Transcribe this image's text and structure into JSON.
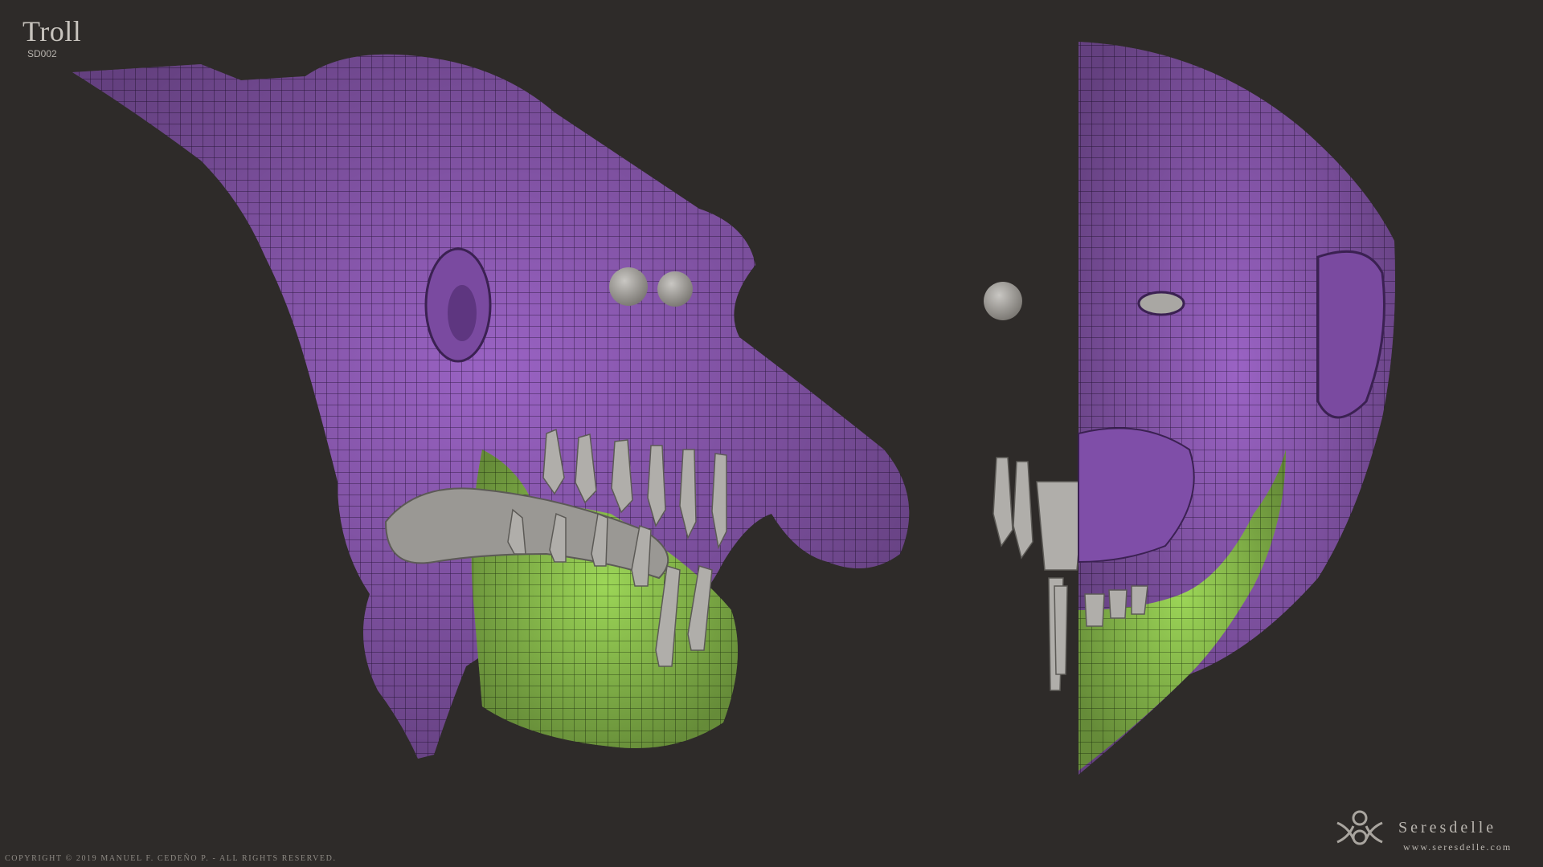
{
  "header": {
    "title": "Troll",
    "code": "SD002"
  },
  "footer": {
    "copyright": "COPYRIGHT © 2019 MANUEL F. CEDEÑO P.  -  ALL RIGHTS RESERVED.",
    "brand": "Seresdelle",
    "brand_url": "www.seresdelle.com"
  },
  "colors": {
    "background": "#2e2b29",
    "mesh_purple": "#9a63c4",
    "mesh_green": "#9cd657",
    "teeth_gray": "#a7a5a1"
  },
  "icons": {
    "logo": "seresdelle-flower-logo"
  }
}
